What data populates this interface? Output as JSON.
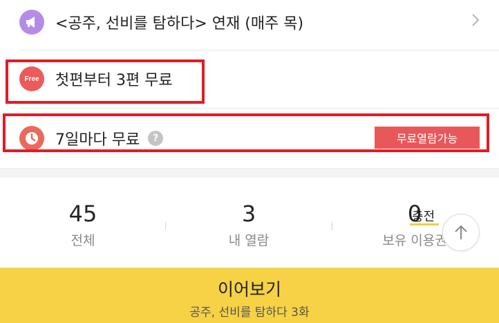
{
  "serial": {
    "icon": "megaphone-icon",
    "text": "<공주, 선비를 탐하다> 연재 (매주 목)"
  },
  "free_first": {
    "icon_label": "Free",
    "text": "첫편부터 3편 무료"
  },
  "wait_free": {
    "icon": "clock-icon",
    "text": "7일마다 무료",
    "help": "?",
    "badge": "무료열람가능"
  },
  "stats": {
    "total": {
      "value": "45",
      "label": "전체"
    },
    "my_views": {
      "value": "3",
      "label": "내 열람"
    },
    "tickets": {
      "value": "0",
      "label": "보유 이용권",
      "charge": "충전"
    }
  },
  "continue": {
    "label": "이어보기",
    "episode": "공주, 선비를 탐하다 3화"
  },
  "colors": {
    "highlight": "#e21b25",
    "accent_yellow": "#f6d244",
    "badge_red": "#e8585a"
  }
}
